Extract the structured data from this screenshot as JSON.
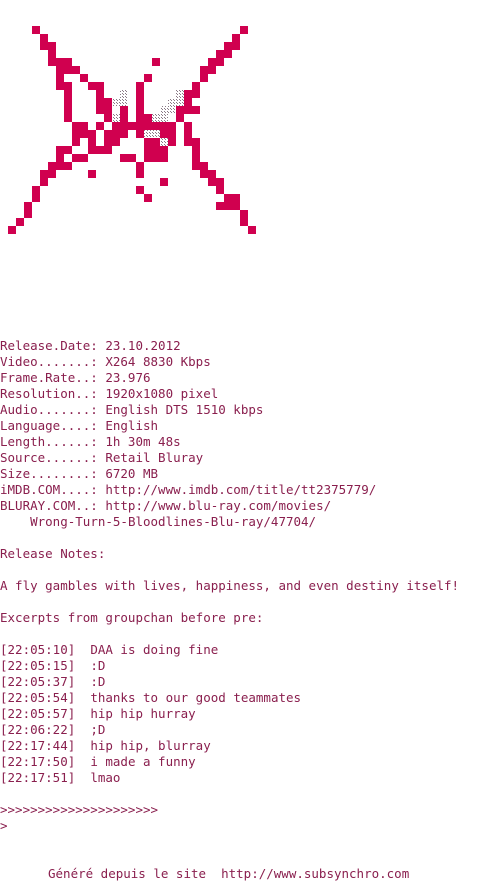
{
  "info": [
    {
      "label": "Release.Date: ",
      "value": "23.10.2012"
    },
    {
      "label": "Video.......: ",
      "value": "X264 8830 Kbps"
    },
    {
      "label": "Frame.Rate..: ",
      "value": "23.976"
    },
    {
      "label": "Resolution..: ",
      "value": "1920x1080 pixel"
    },
    {
      "label": "Audio.......: ",
      "value": "English DTS 1510 kbps"
    },
    {
      "label": "Language....: ",
      "value": "English"
    },
    {
      "label": "Length......: ",
      "value": "1h 30m 48s"
    },
    {
      "label": "Source......: ",
      "value": "Retail Bluray"
    },
    {
      "label": "Size........: ",
      "value": "6720 MB"
    },
    {
      "label": "iMDB.COM....: ",
      "value": "http://www.imdb.com/title/tt2375779/"
    },
    {
      "label": "BLURAY.COM..: ",
      "value": "http://www.blu-ray.com/movies/"
    },
    {
      "label": "    ",
      "value": "Wrong-Turn-5-Bloodlines-Blu-ray/47704/"
    }
  ],
  "notes_header": "Release Notes:",
  "notes_body": "A fly gambles with lives, happiness, and even destiny itself!",
  "excerpt_header": "Excerpts from groupchan before pre:",
  "chat": [
    {
      "time": "[22:05:10]",
      "msg": "DAA is doing fine"
    },
    {
      "time": "[22:05:15]",
      "msg": ":D"
    },
    {
      "time": "[22:05:37]",
      "msg": ":D"
    },
    {
      "time": "[22:05:54]",
      "msg": "thanks to our good teammates"
    },
    {
      "time": "[22:05:57]",
      "msg": "hip hip hurray"
    },
    {
      "time": "[22:06:22]",
      "msg": ";D"
    },
    {
      "time": "[22:17:44]",
      "msg": "hip hip, blurray"
    },
    {
      "time": "[22:17:50]",
      "msg": "i made a funny"
    },
    {
      "time": "[22:17:51]",
      "msg": "lmao"
    }
  ],
  "prompt_line1": ">>>>>>>>>>>>>>>>>>>>>",
  "prompt_line2": ">",
  "footer": "Généré depuis le site  http://www.subsynchro.com",
  "logo": {
    "name": "pixel-art-fly-logo-icon",
    "color": "#d0004f"
  },
  "colors": {
    "text": "#8a1f4e",
    "logo": "#d0004f",
    "background": "#ffffff"
  }
}
